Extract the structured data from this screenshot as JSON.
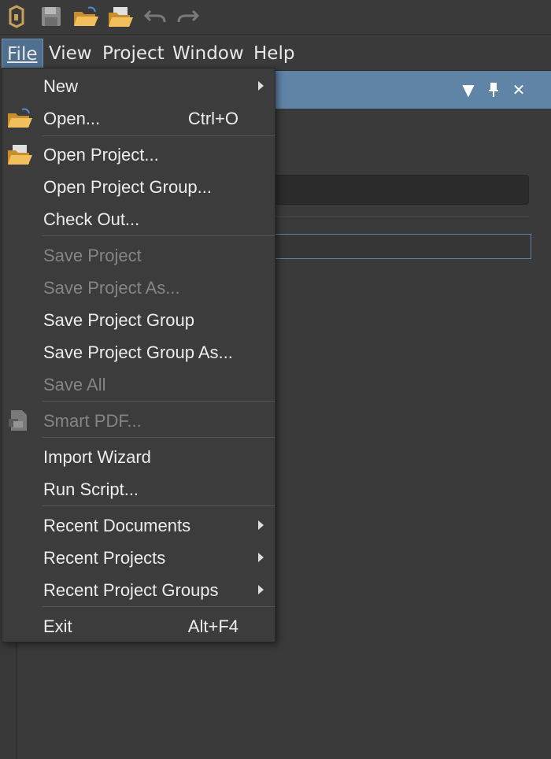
{
  "toolbar": {
    "icons": [
      "app-logo-icon",
      "save-icon",
      "open-folder-icon",
      "open-project-icon",
      "undo-icon",
      "redo-icon"
    ]
  },
  "menubar": {
    "items": [
      {
        "label": "File",
        "mnemonic": "F"
      },
      {
        "label": "View",
        "mnemonic": "V"
      },
      {
        "label": "Project",
        "mnemonic": "j"
      },
      {
        "label": "Window",
        "mnemonic": "W"
      },
      {
        "label": "Help",
        "mnemonic": "H"
      }
    ]
  },
  "file_menu": {
    "new": {
      "label": "New",
      "submenu": true
    },
    "open": {
      "label": "Open...",
      "shortcut": "Ctrl+O",
      "icon": "open-folder-icon"
    },
    "open_project": {
      "label": "Open Project...",
      "icon": "open-project-icon"
    },
    "open_project_group": {
      "label": "Open Project Group..."
    },
    "check_out": {
      "label": "Check Out..."
    },
    "save_project": {
      "label": "Save Project",
      "disabled": true
    },
    "save_project_as": {
      "label": "Save Project As...",
      "disabled": true
    },
    "save_project_group": {
      "label": "Save Project Group"
    },
    "save_project_group_as": {
      "label": "Save Project Group As..."
    },
    "save_all": {
      "label": "Save All",
      "disabled": true
    },
    "smart_pdf": {
      "label": "Smart PDF...",
      "disabled": true,
      "icon": "smart-pdf-icon"
    },
    "import_wizard": {
      "label": "Import Wizard"
    },
    "run_script": {
      "label": "Run Script..."
    },
    "recent_documents": {
      "label": "Recent Documents",
      "submenu": true
    },
    "recent_projects": {
      "label": "Recent Projects",
      "submenu": true
    },
    "recent_project_groups": {
      "label": "Recent Project Groups",
      "submenu": true
    },
    "exit": {
      "label": "Exit",
      "shortcut": "Alt+F4"
    }
  },
  "colors": {
    "accent": "#5f84a6",
    "menu_bg": "#3c3c3c",
    "disabled_text": "#858585",
    "folder_yellow": "#e8b04a"
  }
}
